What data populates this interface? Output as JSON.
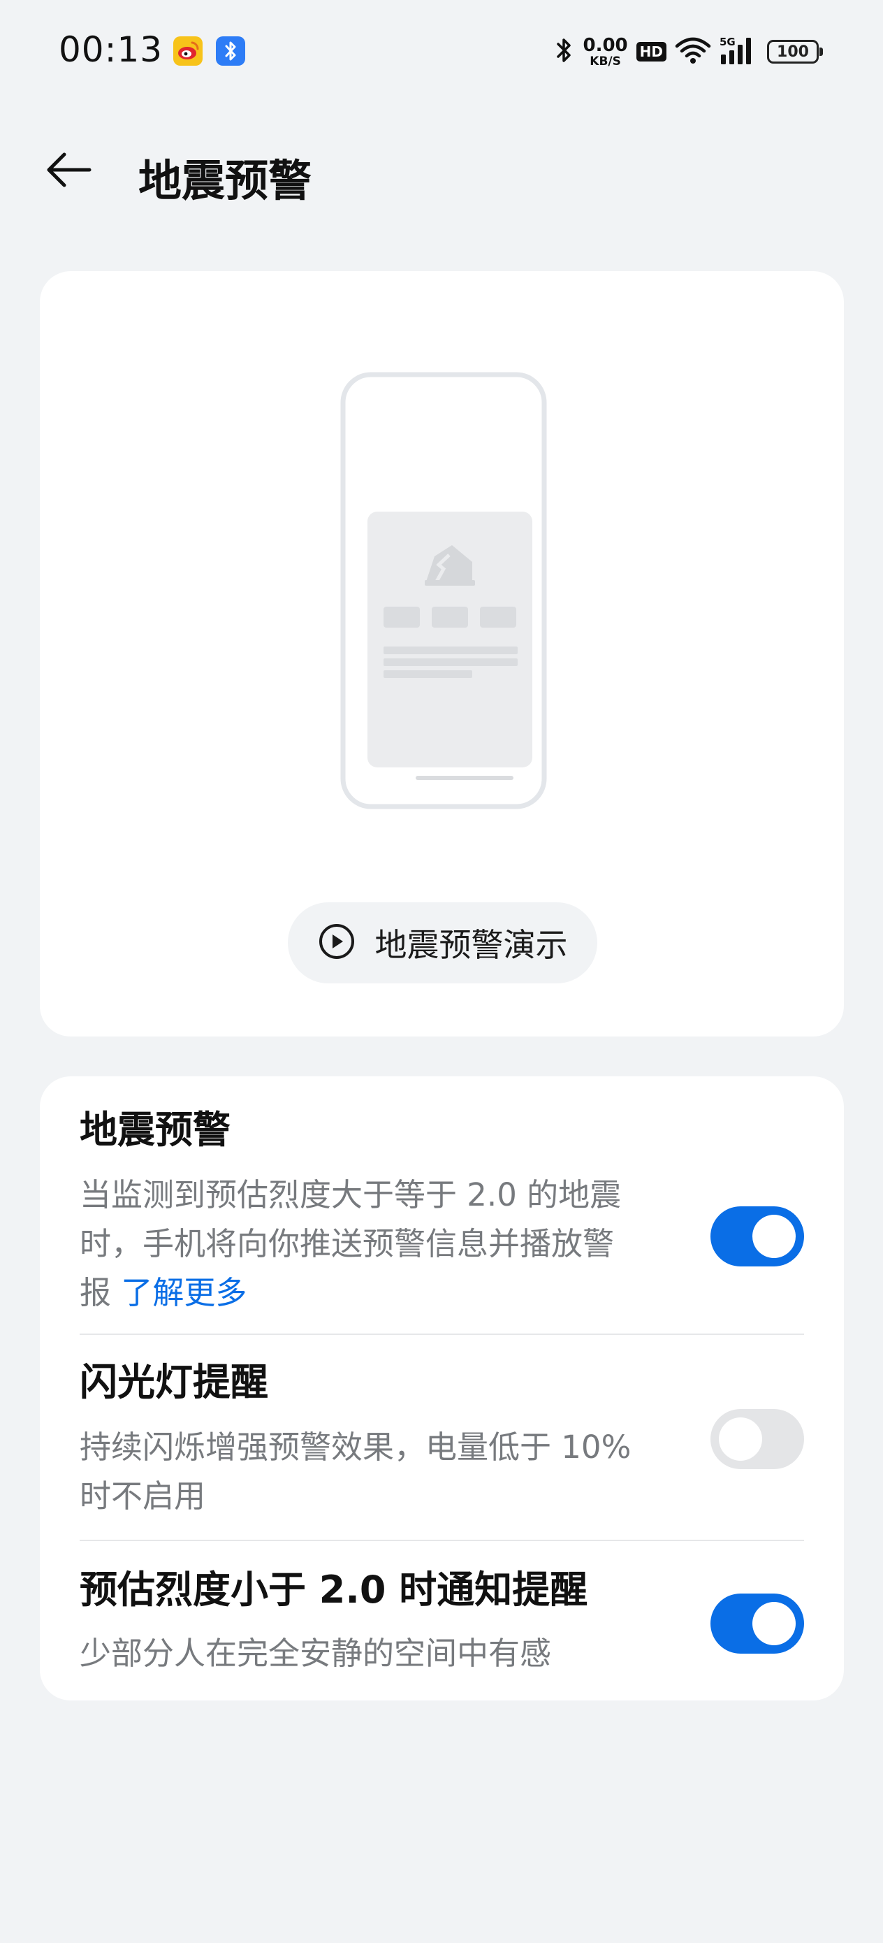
{
  "status_bar": {
    "time": "00:13",
    "app_icons": [
      "weibo-icon",
      "bluetooth-app-icon"
    ],
    "net_speed_value": "0.00",
    "net_speed_unit": "KB/S",
    "hd_label": "HD",
    "signal_label": "5G",
    "battery": "100"
  },
  "header": {
    "back_icon": "arrow-left-icon",
    "title": "地震预警"
  },
  "demo": {
    "illustration": "phone-with-house-alert",
    "button_icon": "play-circle-icon",
    "button_label": "地震预警演示"
  },
  "settings": {
    "items": [
      {
        "title": "地震预警",
        "desc_lines": [
          "当监测到预估烈度大于等于 2.0 的地震",
          "时，手机将向你推送预警信息并播放警",
          "报"
        ],
        "link": "了解更多",
        "enabled": true
      },
      {
        "title": "闪光灯提醒",
        "desc_lines": [
          "持续闪烁增强预警效果，电量低于 10%",
          "时不启用"
        ],
        "enabled": false
      },
      {
        "title": "预估烈度小于 2.0 时通知提醒",
        "desc_lines": [
          "少部分人在完全安静的空间中有感"
        ],
        "enabled": true
      }
    ]
  },
  "colors": {
    "background": "#f1f3f5",
    "card": "#ffffff",
    "accent": "#0a6ee6",
    "toggle_off": "#e4e5e7",
    "secondary_text": "#777a7e"
  }
}
